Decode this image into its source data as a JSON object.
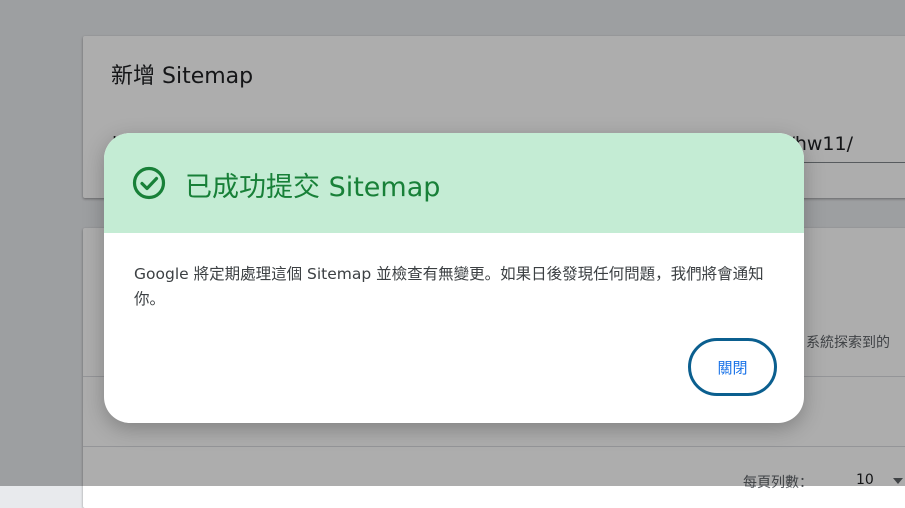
{
  "add_sitemap_card": {
    "title": "新增 Sitemap",
    "url_prefix_fragment": "h",
    "url_input_value_fragment": "/hw11/"
  },
  "sitemaps_card": {
    "description_fragment": "系統探索到的",
    "rows_per_page_label": "每頁列數：",
    "rows_per_page_value": "10"
  },
  "dialog": {
    "title": "已成功提交 Sitemap",
    "message": "Google 將定期處理這個 Sitemap 並檢查有無變更。如果日後發現任何問題，我們將會通知你。",
    "close_label": "關閉",
    "colors": {
      "header_bg": "#c4ecd4",
      "success_green": "#188038",
      "button_border": "#0b5f8f",
      "button_text": "#1a73e8"
    },
    "icon": "check-circle-icon"
  }
}
